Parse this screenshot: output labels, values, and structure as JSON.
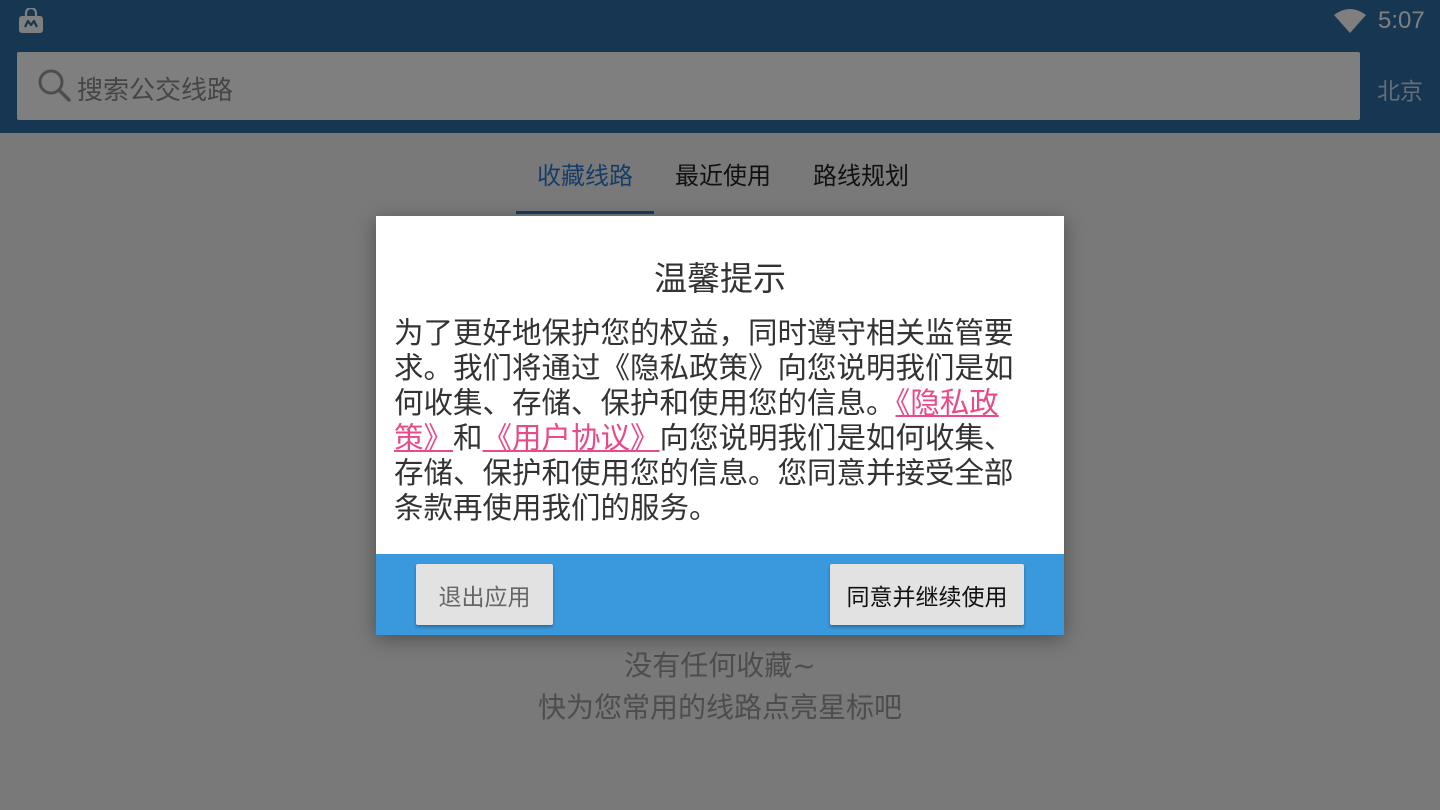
{
  "status_bar": {
    "app_icon": "shopping-bag-icon",
    "wifi_icon": "wifi-icon",
    "time": "5:07"
  },
  "search": {
    "icon": "search-icon",
    "placeholder": "搜索公交线路",
    "city": "北京"
  },
  "tabs": [
    {
      "label": "收藏线路",
      "active": true
    },
    {
      "label": "最近使用",
      "active": false
    },
    {
      "label": "路线规划",
      "active": false
    }
  ],
  "empty_state": {
    "line1": "没有任何收藏~",
    "line2": "快为您常用的线路点亮星标吧"
  },
  "dialog": {
    "title": "温馨提示",
    "body_part1": "为了更好地保护您的权益，同时遵守相关监管要求。我们将通过《隐私政策》向您说明我们是如何收集、存储、保护和使用您的信息。",
    "privacy_link": "《隐私政策》",
    "and_text": "和",
    "agreement_link": "《用户协议》",
    "body_part2": "向您说明我们是如何收集、存储、保护和使用您的信息。您同意并接受全部条款再使用我们的服务。",
    "exit_label": "退出应用",
    "agree_label": "同意并继续使用"
  },
  "colors": {
    "primary": "#2e6da4",
    "tab_active": "#2e7bcf",
    "dialog_footer": "#3a98dc",
    "link": "#e84a8a"
  }
}
